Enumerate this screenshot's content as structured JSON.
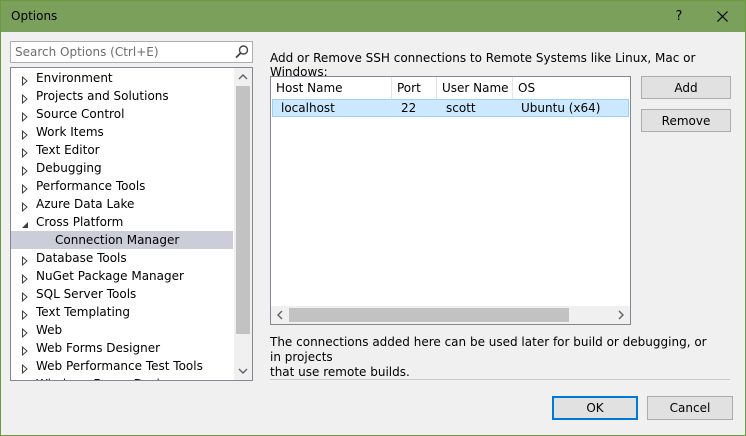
{
  "window": {
    "title": "Options",
    "help_glyph": "?",
    "colors": {
      "titlebar": "#7ba05b",
      "selection": "#cce8ff",
      "tree_selection": "#cdcdda"
    }
  },
  "search": {
    "placeholder": "Search Options (Ctrl+E)",
    "value": ""
  },
  "tree": {
    "items": [
      {
        "label": "Environment",
        "expanded": false
      },
      {
        "label": "Projects and Solutions",
        "expanded": false
      },
      {
        "label": "Source Control",
        "expanded": false
      },
      {
        "label": "Work Items",
        "expanded": false
      },
      {
        "label": "Text Editor",
        "expanded": false
      },
      {
        "label": "Debugging",
        "expanded": false
      },
      {
        "label": "Performance Tools",
        "expanded": false
      },
      {
        "label": "Azure Data Lake",
        "expanded": false
      },
      {
        "label": "Cross Platform",
        "expanded": true
      },
      {
        "label": "Connection Manager",
        "child": true,
        "selected": true
      },
      {
        "label": "Database Tools",
        "expanded": false
      },
      {
        "label": "NuGet Package Manager",
        "expanded": false
      },
      {
        "label": "SQL Server Tools",
        "expanded": false
      },
      {
        "label": "Text Templating",
        "expanded": false
      },
      {
        "label": "Web",
        "expanded": false
      },
      {
        "label": "Web Forms Designer",
        "expanded": false
      },
      {
        "label": "Web Performance Test Tools",
        "expanded": false
      },
      {
        "label": "Windows Forms Designer",
        "expanded": false
      }
    ]
  },
  "main": {
    "description": "Add or Remove SSH connections to Remote Systems like Linux, Mac or Windows:",
    "columns": [
      "Host Name",
      "Port",
      "User Name",
      "OS"
    ],
    "rows": [
      {
        "host": "localhost",
        "port": "22",
        "user": "scott",
        "os": "Ubuntu (x64)"
      }
    ],
    "add_label": "Add",
    "remove_label": "Remove",
    "note_line1": "The connections added here can be used later for build or debugging, or in projects",
    "note_line2": "that use remote builds."
  },
  "footer": {
    "ok_label": "OK",
    "cancel_label": "Cancel"
  }
}
